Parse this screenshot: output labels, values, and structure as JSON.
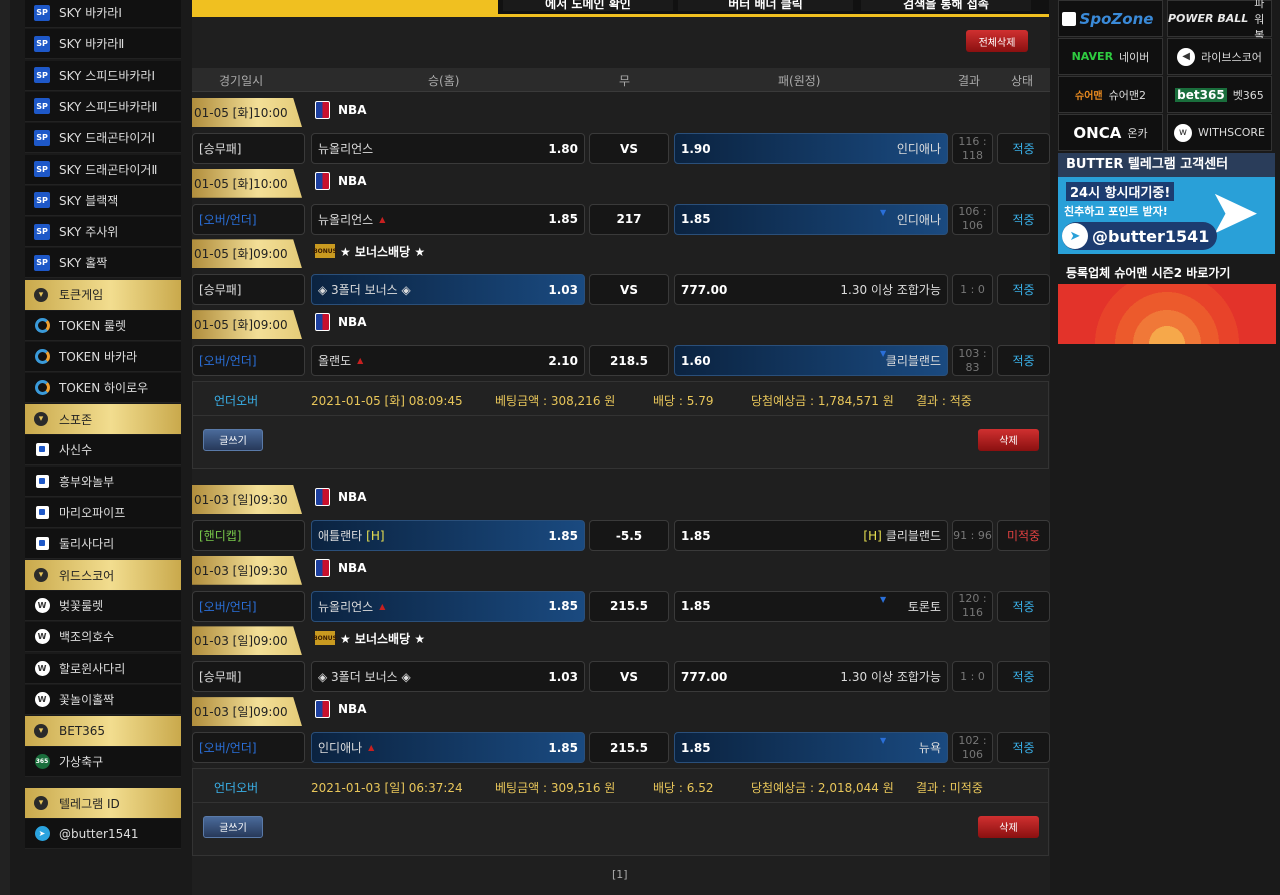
{
  "sidebar": {
    "items": [
      {
        "label": "SKY 바카라Ⅰ",
        "icon": "sp-icon"
      },
      {
        "label": "SKY 바카라Ⅱ",
        "icon": "sp-icon"
      },
      {
        "label": "SKY 스피드바카라Ⅰ",
        "icon": "sp-icon"
      },
      {
        "label": "SKY 스피드바카라Ⅱ",
        "icon": "sp-icon"
      },
      {
        "label": "SKY 드래곤타이거Ⅰ",
        "icon": "sp-icon"
      },
      {
        "label": "SKY 드래곤타이거Ⅱ",
        "icon": "sp-icon"
      },
      {
        "label": "SKY 블랙잭",
        "icon": "sp-icon"
      },
      {
        "label": "SKY 주사위",
        "icon": "sp-icon"
      },
      {
        "label": "SKY 홀짝",
        "icon": "sp-icon"
      }
    ],
    "sections": [
      {
        "title": "토큰게임",
        "items": [
          "TOKEN 룰렛",
          "TOKEN 바카라",
          "TOKEN 하이로우"
        ]
      },
      {
        "title": "스포존",
        "items": [
          "사신수",
          "흥부와놀부",
          "마리오파이프",
          "둘리사다리"
        ]
      },
      {
        "title": "위드스코어",
        "items": [
          "벚꽃룰렛",
          "백조의호수",
          "할로윈사다리",
          "꽃놀이홀짝"
        ]
      },
      {
        "title": "BET365",
        "items": [
          "가상축구"
        ]
      },
      {
        "title": "텔레그램 ID",
        "items": [
          "@butter1541"
        ]
      }
    ]
  },
  "banner": {
    "texts": [
      "에서 도메인 확인",
      "버터 배너 클릭",
      "검색을 통해 접속"
    ]
  },
  "toolbar": {
    "delete_all": "전체삭제"
  },
  "table_header": {
    "date": "경기일시",
    "home": "승(홈)",
    "draw": "무",
    "away": "패(원정)",
    "result": "결과",
    "status": "상태"
  },
  "slips": [
    {
      "rows": [
        {
          "date": "01-05 [화]10:00",
          "league": "NBA",
          "type": "[승무패]",
          "home": "뉴올리언스",
          "home_odd": "1.80",
          "mid": "VS",
          "away_odd": "1.90",
          "away": "인디애나",
          "result": "116 : 118",
          "status": "적중"
        },
        {
          "date": "01-05 [화]10:00",
          "league": "NBA",
          "type": "[오버/언더]",
          "home": "뉴올리언스",
          "home_odd": "1.85",
          "mid": "217",
          "away_odd": "1.85",
          "away": "인디애나",
          "result": "106 : 106",
          "status": "적중"
        },
        {
          "date": "01-05 [화]09:00",
          "league": "★ 보너스배당 ★",
          "type": "[승무패]",
          "home": "◈ 3폴더 보너스 ◈",
          "home_odd": "1.03",
          "mid": "VS",
          "away_odd": "777.00",
          "away": "1.30 이상 조합가능",
          "result": "1 : 0",
          "status": "적중"
        },
        {
          "date": "01-05 [화]09:00",
          "league": "NBA",
          "type": "[오버/언더]",
          "home": "올랜도",
          "home_odd": "2.10",
          "mid": "218.5",
          "away_odd": "1.60",
          "away": "클리블랜드",
          "result": "103 : 83",
          "status": "적중"
        }
      ],
      "summary": {
        "kind": "언더오버",
        "time": "2021-01-05 [화] 08:09:45",
        "bet": "베팅금액 : 308,216 원",
        "odds": "배당 : 5.79",
        "expected": "당첨예상금 : 1,784,571 원",
        "result": "결과 : 적중"
      },
      "write": "글쓰기",
      "delete": "삭제"
    },
    {
      "rows": [
        {
          "date": "01-03 [일]09:30",
          "league": "NBA",
          "type": "[핸디캡]",
          "home": "애틀랜타",
          "home_tag": "[H]",
          "home_odd": "1.85",
          "mid": "-5.5",
          "away_odd": "1.85",
          "away_tag": "[H]",
          "away": "클리블랜드",
          "result": "91 : 96",
          "status": "미적중"
        },
        {
          "date": "01-03 [일]09:30",
          "league": "NBA",
          "type": "[오버/언더]",
          "home": "뉴올리언스",
          "home_odd": "1.85",
          "mid": "215.5",
          "away_odd": "1.85",
          "away": "토론토",
          "result": "120 : 116",
          "status": "적중"
        },
        {
          "date": "01-03 [일]09:00",
          "league": "★ 보너스배당 ★",
          "type": "[승무패]",
          "home": "◈ 3폴더 보너스 ◈",
          "home_odd": "1.03",
          "mid": "VS",
          "away_odd": "777.00",
          "away": "1.30 이상 조합가능",
          "result": "1 : 0",
          "status": "적중"
        },
        {
          "date": "01-03 [일]09:00",
          "league": "NBA",
          "type": "[오버/언더]",
          "home": "인디애나",
          "home_odd": "1.85",
          "mid": "215.5",
          "away_odd": "1.85",
          "away": "뉴욕",
          "result": "102 : 106",
          "status": "적중"
        }
      ],
      "summary": {
        "kind": "언더오버",
        "time": "2021-01-03 [일] 06:37:24",
        "bet": "베팅금액 : 309,516 원",
        "odds": "배당 : 6.52",
        "expected": "당첨예상금 : 2,018,044 원",
        "result": "결과 : 미적중"
      },
      "write": "글쓰기",
      "delete": "삭제"
    }
  ],
  "pagination": "[1]",
  "right": {
    "links": [
      {
        "logo": "SpoZone",
        "label": ""
      },
      {
        "logo": "POWER BALL",
        "label": "파워볼"
      },
      {
        "logo": "NAVER",
        "label": "네이버"
      },
      {
        "logo": "",
        "label": "라이브스코어"
      },
      {
        "logo": "슈어맨",
        "label": "슈어맨2"
      },
      {
        "logo": "bet365",
        "label": "벳365"
      },
      {
        "logo": "ONCA",
        "label": "온카"
      },
      {
        "logo": "",
        "label": "WITHSCORE"
      }
    ],
    "telegram_banner": {
      "title": "BUTTER 텔레그램 고객센터",
      "line1": "24시 항시대기중!",
      "line2": "친추하고 포인트 받자!",
      "id": "@butter1541"
    },
    "sureman_banner": {
      "text": "등록업체 슈어맨 시즌2 바로가기"
    }
  }
}
